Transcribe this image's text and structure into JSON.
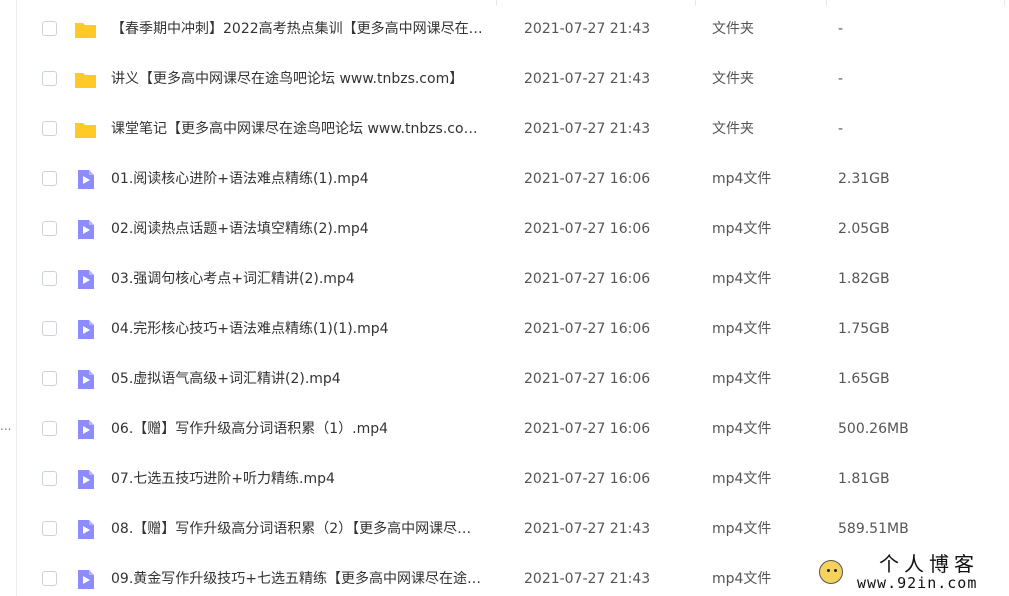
{
  "left_panel": {
    "ellipsis": "..."
  },
  "colors": {
    "folder": "#ffca28",
    "video": "#8c8cff",
    "text": "#333333",
    "secondary_text": "#555555",
    "checkbox_border": "#cfd3d9"
  },
  "files": [
    {
      "icon": "folder-icon",
      "name": "【春季期中冲刺】2022高考热点集训【更多高中网课尽在…",
      "modified": "2021-07-27 21:43",
      "type": "文件夹",
      "size": "-"
    },
    {
      "icon": "folder-icon",
      "name": "讲义【更多高中网课尽在途鸟吧论坛 www.tnbzs.com】",
      "modified": "2021-07-27 21:43",
      "type": "文件夹",
      "size": "-"
    },
    {
      "icon": "folder-icon",
      "name": "课堂笔记【更多高中网课尽在途鸟吧论坛 www.tnbzs.co…",
      "modified": "2021-07-27 21:43",
      "type": "文件夹",
      "size": "-"
    },
    {
      "icon": "video-file-icon",
      "name": "01.阅读核心进阶+语法难点精练(1).mp4",
      "modified": "2021-07-27 16:06",
      "type": "mp4文件",
      "size": "2.31GB"
    },
    {
      "icon": "video-file-icon",
      "name": "02.阅读热点话题+语法填空精练(2).mp4",
      "modified": "2021-07-27 16:06",
      "type": "mp4文件",
      "size": "2.05GB"
    },
    {
      "icon": "video-file-icon",
      "name": "03.强调句核心考点+词汇精讲(2).mp4",
      "modified": "2021-07-27 16:06",
      "type": "mp4文件",
      "size": "1.82GB"
    },
    {
      "icon": "video-file-icon",
      "name": "04.完形核心技巧+语法难点精练(1)(1).mp4",
      "modified": "2021-07-27 16:06",
      "type": "mp4文件",
      "size": "1.75GB"
    },
    {
      "icon": "video-file-icon",
      "name": "05.虚拟语气高级+词汇精讲(2).mp4",
      "modified": "2021-07-27 16:06",
      "type": "mp4文件",
      "size": "1.65GB"
    },
    {
      "icon": "video-file-icon",
      "name": "06.【赠】写作升级高分词语积累（1）.mp4",
      "modified": "2021-07-27 16:06",
      "type": "mp4文件",
      "size": "500.26MB"
    },
    {
      "icon": "video-file-icon",
      "name": "07.七选五技巧进阶+听力精练.mp4",
      "modified": "2021-07-27 16:06",
      "type": "mp4文件",
      "size": "1.81GB"
    },
    {
      "icon": "video-file-icon",
      "name": "08.【赠】写作升级高分词语积累（2）【更多高中网课尽…",
      "modified": "2021-07-27 21:43",
      "type": "mp4文件",
      "size": "589.51MB"
    },
    {
      "icon": "video-file-icon",
      "name": "09.黄金写作升级技巧+七选五精练【更多高中网课尽在途…",
      "modified": "2021-07-27 21:43",
      "type": "mp4文件",
      "size": ""
    }
  ],
  "watermark": {
    "title": "个人博客",
    "url": "www.92in.com"
  }
}
